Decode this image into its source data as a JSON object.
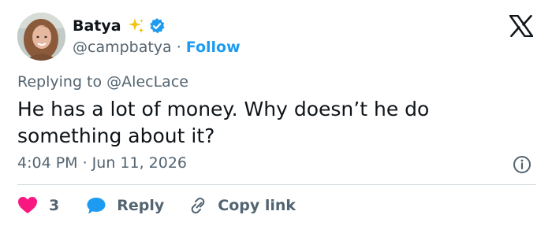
{
  "author": {
    "display_name": "Batya",
    "handle": "@campbatya",
    "separator": "·",
    "follow_label": "Follow",
    "verified": true,
    "emoji": "sparkles"
  },
  "tweet": {
    "replying_prefix": "Replying to",
    "replying_to": "@AlecLace",
    "text": "He has a lot of money. Why doesn’t he do something about it?",
    "timestamp": "4:04 PM · Jun 11, 2026"
  },
  "actions": {
    "like_count": "3",
    "reply_label": "Reply",
    "copy_link_label": "Copy link"
  },
  "colors": {
    "accent": "#1d9bf0",
    "like": "#f91880",
    "text": "#0f1419",
    "secondary": "#536471",
    "divider": "#cfd9de"
  },
  "icons": [
    "x-logo-icon",
    "sparkles-icon",
    "verified-badge-icon",
    "info-icon",
    "heart-icon",
    "reply-bubble-icon",
    "link-icon"
  ]
}
